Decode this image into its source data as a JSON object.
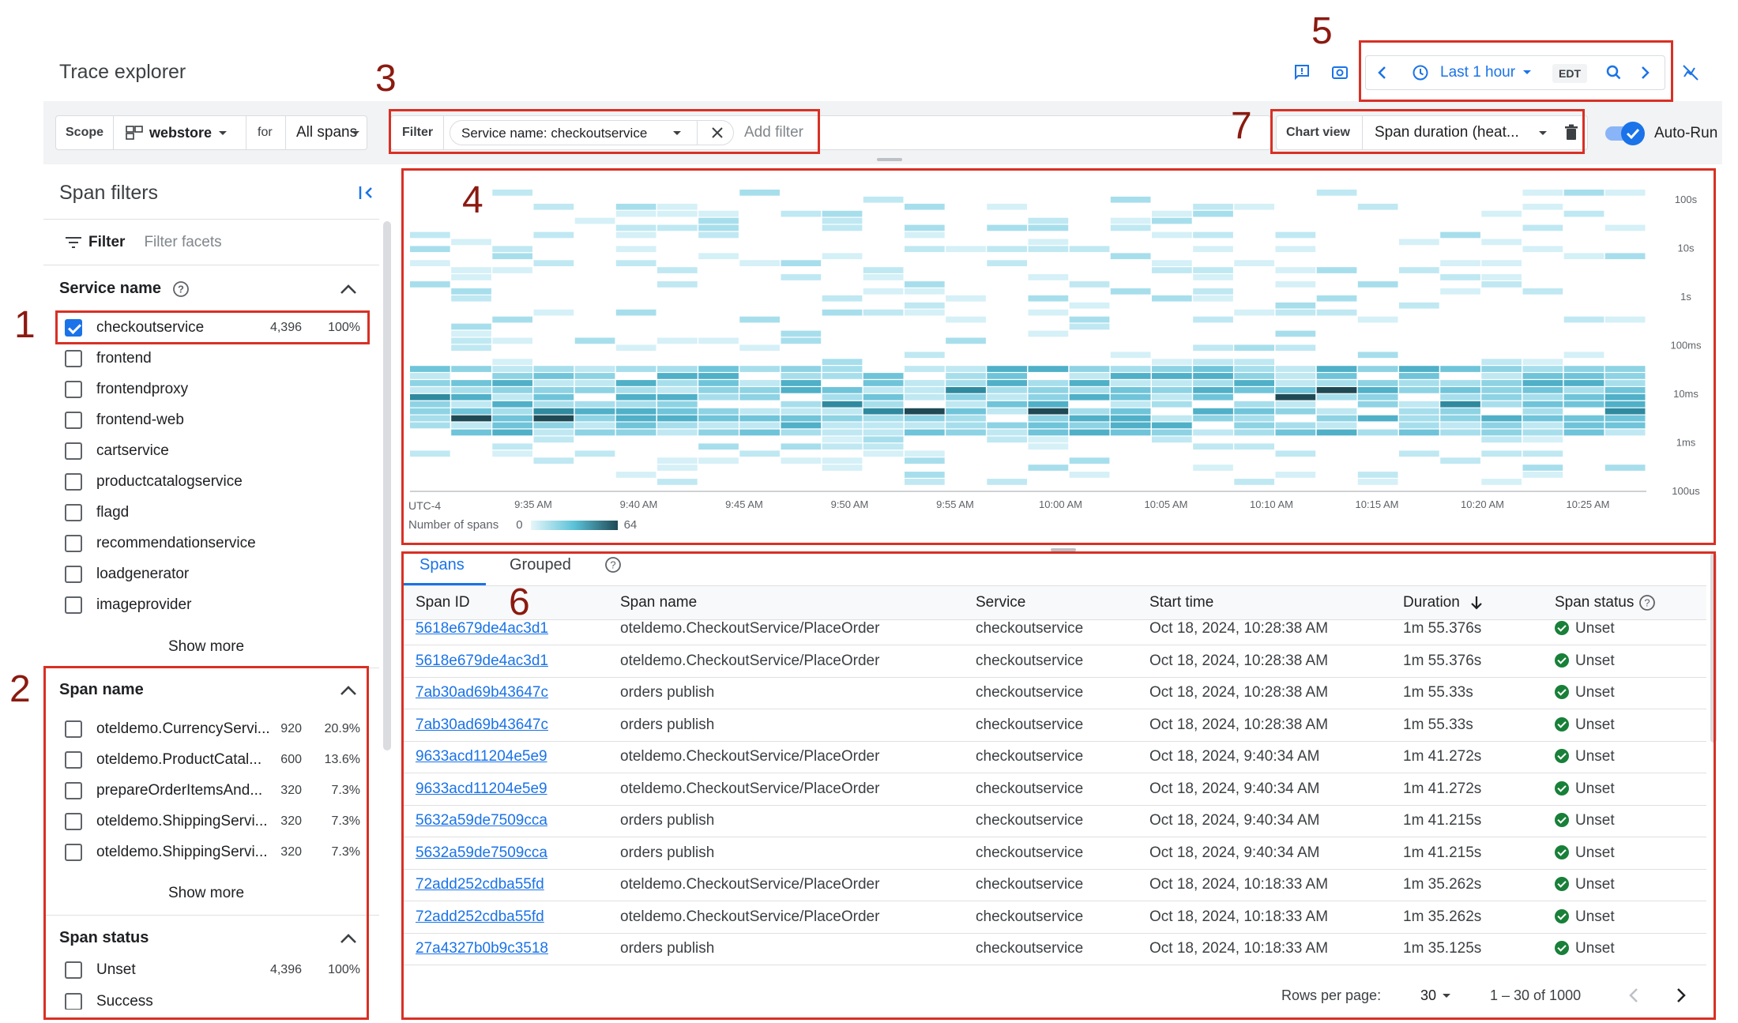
{
  "header": {
    "title": "Trace explorer"
  },
  "time_range": {
    "label": "Last 1 hour",
    "timezone": "EDT"
  },
  "toolbar": {
    "scope_label": "Scope",
    "scope_value": "webstore",
    "for_label": "for",
    "for_value": "All spans",
    "filter_label": "Filter",
    "filter_chip": "Service name: checkoutservice",
    "add_filter": "Add filter",
    "chart_view_label": "Chart view",
    "chart_view_value": "Span duration (heat...",
    "auto_run": "Auto-Run"
  },
  "sidebar": {
    "title": "Span filters",
    "filter_label": "Filter",
    "filter_placeholder": "Filter facets",
    "service_name": {
      "title": "Service name",
      "items": [
        {
          "label": "checkoutservice",
          "count": "4,396",
          "pct": "100%",
          "checked": true
        },
        {
          "label": "frontend"
        },
        {
          "label": "frontendproxy"
        },
        {
          "label": "frontend-web"
        },
        {
          "label": "cartservice"
        },
        {
          "label": "productcatalogservice"
        },
        {
          "label": "flagd"
        },
        {
          "label": "recommendationservice"
        },
        {
          "label": "loadgenerator"
        },
        {
          "label": "imageprovider"
        }
      ],
      "show_more": "Show more"
    },
    "span_name": {
      "title": "Span name",
      "items": [
        {
          "label": "oteldemo.CurrencyServi...",
          "count": "920",
          "pct": "20.9%"
        },
        {
          "label": "oteldemo.ProductCatal...",
          "count": "600",
          "pct": "13.6%"
        },
        {
          "label": "prepareOrderItemsAnd...",
          "count": "320",
          "pct": "7.3%"
        },
        {
          "label": "oteldemo.ShippingServi...",
          "count": "320",
          "pct": "7.3%"
        },
        {
          "label": "oteldemo.ShippingServi...",
          "count": "320",
          "pct": "7.3%"
        }
      ],
      "show_more": "Show more"
    },
    "span_status": {
      "title": "Span status",
      "items": [
        {
          "label": "Unset",
          "count": "4,396",
          "pct": "100%"
        },
        {
          "label": "Success"
        }
      ]
    }
  },
  "chart_data": {
    "type": "heatmap",
    "timezone_label": "UTC-4",
    "x_ticks": [
      "9:35 AM",
      "9:40 AM",
      "9:45 AM",
      "9:50 AM",
      "9:55 AM",
      "10:00 AM",
      "10:05 AM",
      "10:10 AM",
      "10:15 AM",
      "10:20 AM",
      "10:25 AM"
    ],
    "y_ticks": [
      "100s",
      "10s",
      "1s",
      "100ms",
      "10ms",
      "1ms",
      "100us"
    ],
    "legend": {
      "label": "Number of spans",
      "min": "0",
      "max": "64"
    },
    "colors": {
      "low": "#cfeef6",
      "high": "#1f4a55"
    }
  },
  "annotations": [
    "1",
    "2",
    "3",
    "4",
    "5",
    "6",
    "7"
  ],
  "table": {
    "tabs": [
      "Spans",
      "Grouped"
    ],
    "columns": [
      "Span ID",
      "Span name",
      "Service",
      "Start time",
      "Duration",
      "Span status"
    ],
    "rows": [
      [
        "5618e679de4ac3d1",
        "oteldemo.CheckoutService/PlaceOrder",
        "checkoutservice",
        "Oct 18, 2024, 10:28:38 AM",
        "1m 55.376s",
        "Unset"
      ],
      [
        "5618e679de4ac3d1",
        "oteldemo.CheckoutService/PlaceOrder",
        "checkoutservice",
        "Oct 18, 2024, 10:28:38 AM",
        "1m 55.376s",
        "Unset"
      ],
      [
        "7ab30ad69b43647c",
        "orders publish",
        "checkoutservice",
        "Oct 18, 2024, 10:28:38 AM",
        "1m 55.33s",
        "Unset"
      ],
      [
        "7ab30ad69b43647c",
        "orders publish",
        "checkoutservice",
        "Oct 18, 2024, 10:28:38 AM",
        "1m 55.33s",
        "Unset"
      ],
      [
        "9633acd11204e5e9",
        "oteldemo.CheckoutService/PlaceOrder",
        "checkoutservice",
        "Oct 18, 2024, 9:40:34 AM",
        "1m 41.272s",
        "Unset"
      ],
      [
        "9633acd11204e5e9",
        "oteldemo.CheckoutService/PlaceOrder",
        "checkoutservice",
        "Oct 18, 2024, 9:40:34 AM",
        "1m 41.272s",
        "Unset"
      ],
      [
        "5632a59de7509cca",
        "orders publish",
        "checkoutservice",
        "Oct 18, 2024, 9:40:34 AM",
        "1m 41.215s",
        "Unset"
      ],
      [
        "5632a59de7509cca",
        "orders publish",
        "checkoutservice",
        "Oct 18, 2024, 9:40:34 AM",
        "1m 41.215s",
        "Unset"
      ],
      [
        "72add252cdba55fd",
        "oteldemo.CheckoutService/PlaceOrder",
        "checkoutservice",
        "Oct 18, 2024, 10:18:33 AM",
        "1m 35.262s",
        "Unset"
      ],
      [
        "72add252cdba55fd",
        "oteldemo.CheckoutService/PlaceOrder",
        "checkoutservice",
        "Oct 18, 2024, 10:18:33 AM",
        "1m 35.262s",
        "Unset"
      ],
      [
        "27a4327b0b9c3518",
        "orders publish",
        "checkoutservice",
        "Oct 18, 2024, 10:18:33 AM",
        "1m 35.125s",
        "Unset"
      ]
    ],
    "pagination": {
      "rows_label": "Rows per page:",
      "rows_value": "30",
      "range": "1 – 30 of 1000"
    }
  }
}
